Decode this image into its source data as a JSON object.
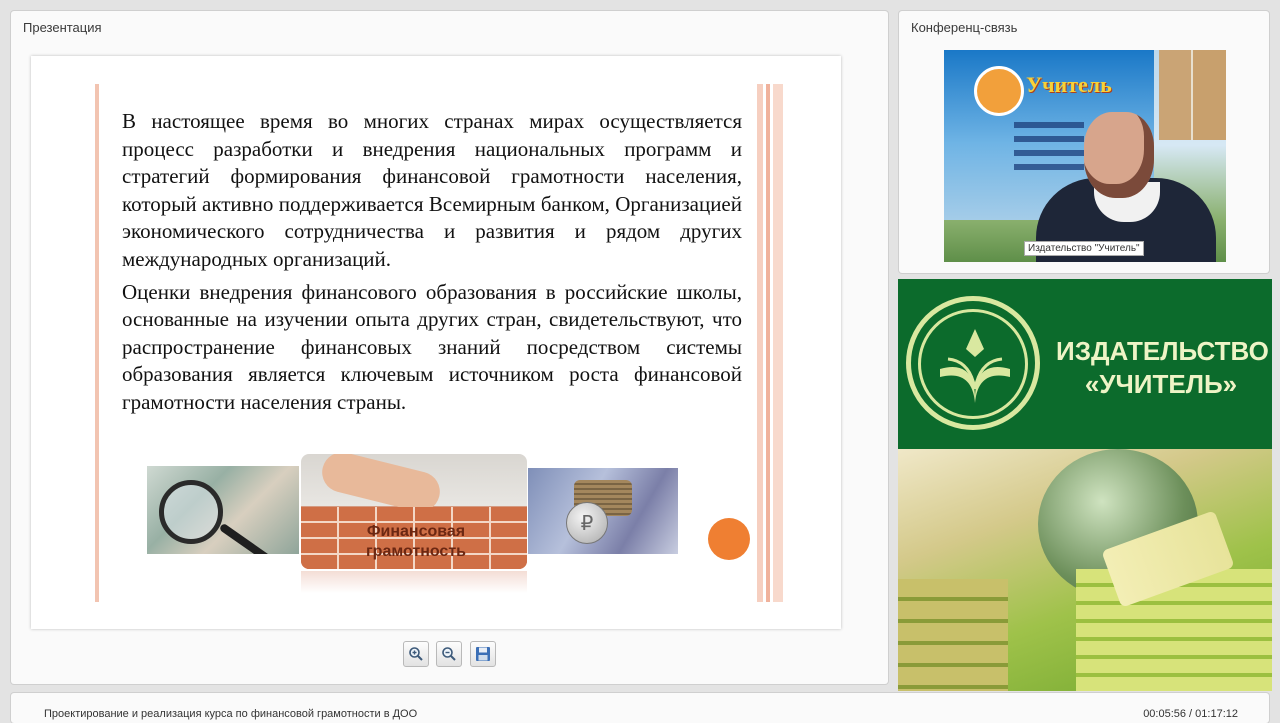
{
  "presentation_panel": {
    "title": "Презентация"
  },
  "slide": {
    "paragraph_1": "В настоящее время во многих странах мирах осуществляется процесс разработки и внедрения национальных программ и стратегий формирования финансовой грамотности населения, который активно поддерживается Всемирным банком, Организацией экономического сотрудничества и развития и рядом других международных организаций.",
    "paragraph_2": "Оценки внедрения финансового образования в российские школы, основанные на изучении опыта других стран, свидетельствуют, что распространение финансовых знаний посредством системы образования является ключевым источником роста финансовой грамотности населения страны.",
    "image_label": "Финансовая грамотность",
    "accent_color": "#ef7f32"
  },
  "toolbar": {
    "zoom_in_icon": "zoom-in-icon",
    "zoom_out_icon": "zoom-out-icon",
    "save_icon": "save-icon"
  },
  "conference_panel": {
    "title": "Конференц-связь",
    "poster_word": "Учитель",
    "video_caption": "Издательство \"Учитель\""
  },
  "brand": {
    "text": "ИЗДАТЕЛЬСТВО «УЧИТЕЛЬ»",
    "background_color": "#0c6b2c"
  },
  "footer": {
    "course_title": "Проектирование и реализация курса по финансовой грамотности в ДОО",
    "playback_time": "00:05:56 / 01:17:12"
  }
}
